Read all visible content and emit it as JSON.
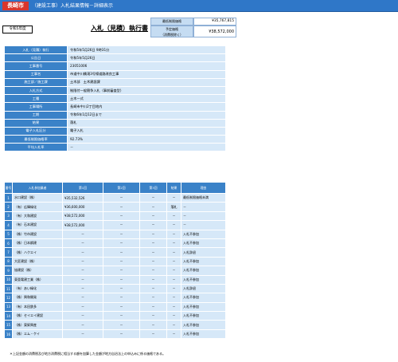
{
  "header": {
    "city": "長崎市",
    "title": "（建設工事）入札結果情報－詳細表示"
  },
  "year": "令和5年度",
  "page_title": "入札（見積）執行書",
  "prices": {
    "min_label": "最低制限価格",
    "min_value": "¥35,767,815",
    "est_label_1": "予定価格",
    "est_label_2": "（消費税除く）",
    "est_value": "¥38,572,000"
  },
  "info": [
    {
      "label": "入札（見積）執行",
      "value": "令和5年5月26日 9時31分"
    },
    {
      "label": "公告日",
      "value": "令和5年5月26日"
    },
    {
      "label": "工事番号",
      "value": "23051006"
    },
    {
      "label": "工事名",
      "value": "市道中川橋滝3号線道路改良工事"
    },
    {
      "label": "施工部／施工課",
      "value": "土木部　土木建設課"
    },
    {
      "label": "入札方式",
      "value": "制限付一般競争入札（事前審査型）"
    },
    {
      "label": "工種",
      "value": "土木一式"
    },
    {
      "label": "工事場所",
      "value": "長崎市中川2丁目地内"
    },
    {
      "label": "工期",
      "value": "令和6年1月12日まで"
    },
    {
      "label": "結果",
      "value": "落札"
    },
    {
      "label": "電子入札区分",
      "value": "電子入札"
    },
    {
      "label": "最低制限価格率",
      "value": "92.73%"
    },
    {
      "label": "平均入札率",
      "value": "－"
    }
  ],
  "bid_headers": {
    "no": "番号",
    "name": "入札参加業者",
    "r1": "第1回",
    "r2": "第2回",
    "r3": "第3回",
    "result": "結果",
    "reason": "理由"
  },
  "bids": [
    {
      "no": "1",
      "name": "水口建設（株）",
      "r1": "¥35,532,526",
      "r2": "－",
      "r3": "－",
      "result": "－",
      "reason": "最低制限価格未満"
    },
    {
      "no": "2",
      "name": "（有）広輝緑化",
      "r1": "¥36,600,000",
      "r2": "－",
      "r3": "－",
      "result": "落札",
      "reason": "－"
    },
    {
      "no": "3",
      "name": "（有）大和建設",
      "r1": "¥38,572,000",
      "r2": "－",
      "r3": "－",
      "result": "－",
      "reason": "－"
    },
    {
      "no": "4",
      "name": "（有）石本建設",
      "r1": "¥38,572,000",
      "r2": "－",
      "r3": "－",
      "result": "－",
      "reason": "－"
    },
    {
      "no": "5",
      "name": "（株）竹市建設",
      "r1": "－",
      "r2": "－",
      "r3": "－",
      "result": "－",
      "reason": "入札不参加"
    },
    {
      "no": "6",
      "name": "（株）日本鋼建",
      "r1": "－",
      "r2": "－",
      "r3": "－",
      "result": "－",
      "reason": "入札不参加"
    },
    {
      "no": "7",
      "name": "（株）ハクエイ",
      "r1": "－",
      "r2": "－",
      "r3": "－",
      "result": "－",
      "reason": "入札辞退"
    },
    {
      "no": "8",
      "name": "大匠建設（株）",
      "r1": "－",
      "r2": "－",
      "r3": "－",
      "result": "－",
      "reason": "入札不参加"
    },
    {
      "no": "9",
      "name": "協建設（株）",
      "r1": "－",
      "r2": "－",
      "r3": "－",
      "result": "－",
      "reason": "入札不参加"
    },
    {
      "no": "10",
      "name": "東亜電建工業（株）",
      "r1": "－",
      "r2": "－",
      "r3": "－",
      "result": "－",
      "reason": "入札不参加"
    },
    {
      "no": "11",
      "name": "（有）あい緑化",
      "r1": "－",
      "r2": "－",
      "r3": "－",
      "result": "－",
      "reason": "入札辞退"
    },
    {
      "no": "12",
      "name": "（株）興和開発",
      "r1": "－",
      "r2": "－",
      "r3": "－",
      "result": "－",
      "reason": "入札不参加"
    },
    {
      "no": "13",
      "name": "（有）本田鉄多",
      "r1": "－",
      "r2": "－",
      "r3": "－",
      "result": "－",
      "reason": "入札不参加"
    },
    {
      "no": "14",
      "name": "（株）セイエイ建設",
      "r1": "－",
      "r2": "－",
      "r3": "－",
      "result": "－",
      "reason": "入札不参加"
    },
    {
      "no": "15",
      "name": "（株）東昇興産",
      "r1": "－",
      "r2": "－",
      "r3": "－",
      "result": "－",
      "reason": "入札不参加"
    },
    {
      "no": "16",
      "name": "（株）エム・ケイ",
      "r1": "－",
      "r2": "－",
      "r3": "－",
      "result": "－",
      "reason": "入札不参加"
    }
  ],
  "footnote": "＊上記金額の消費税及び地方消費税に相当する額を加算した金額が地方自治法上の申込みに係る価格である。",
  "colors": {
    "header": "#2f77c8",
    "badge": "#d9362c",
    "label_bg": "#3a82c8",
    "cell_bg": "#d6e8f8"
  }
}
